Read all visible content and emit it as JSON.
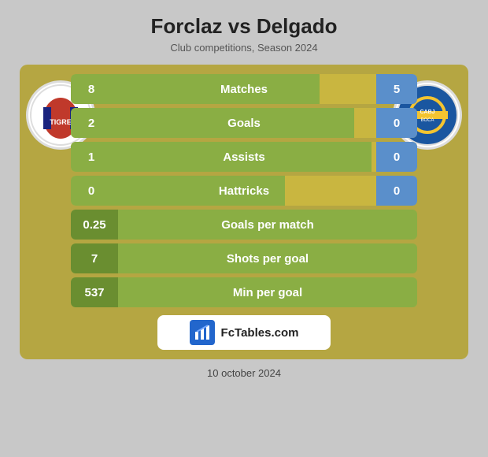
{
  "header": {
    "title": "Forclaz vs Delgado",
    "subtitle": "Club competitions, Season 2024"
  },
  "stats": {
    "matches": {
      "label": "Matches",
      "left": "8",
      "right": "5",
      "bar_pct": 60
    },
    "goals": {
      "label": "Goals",
      "left": "2",
      "right": "0",
      "bar_pct": 70
    },
    "assists": {
      "label": "Assists",
      "left": "1",
      "right": "0",
      "bar_pct": 75
    },
    "hattricks": {
      "label": "Hattricks",
      "left": "0",
      "right": "0",
      "bar_pct": 50
    },
    "goals_per_match": {
      "label": "Goals per match",
      "val": "0.25"
    },
    "shots_per_goal": {
      "label": "Shots per goal",
      "val": "7"
    },
    "min_per_goal": {
      "label": "Min per goal",
      "val": "537"
    }
  },
  "fctables": {
    "text": "FcTables.com"
  },
  "footer": {
    "date": "10 october 2024"
  },
  "teams": {
    "left": "TIGRE",
    "right": "CABJ"
  }
}
